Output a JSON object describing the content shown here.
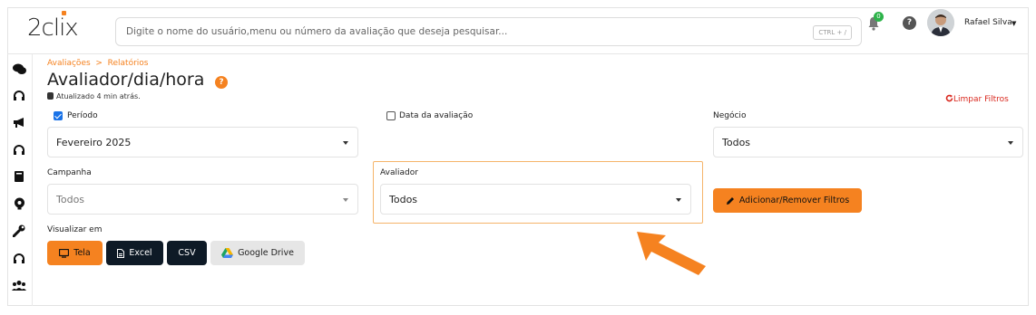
{
  "header": {
    "logo_text_a": "2cl",
    "logo_text_b": "i",
    "logo_text_c": "x",
    "search_placeholder": "Digite o nome do usuário,menu ou número da avaliação que deseja pesquisar...",
    "search_shortcut": "CTRL + /",
    "notification_count": "0",
    "help_glyph": "?",
    "user_name": "Rafael Silva",
    "user_caret": "▼"
  },
  "breadcrumb": {
    "text": "Avaliações  >  Relatórios"
  },
  "page": {
    "title": "Avaliador/dia/hora",
    "title_help_glyph": "?",
    "updated": "Atualizado 4 min atrás.",
    "clear_filters": "Limpar Filtros"
  },
  "filters": {
    "periodo_label": "Período",
    "periodo_checked": true,
    "periodo_value": "Fevereiro 2025",
    "data_avaliacao_label": "Data da avaliação",
    "data_avaliacao_checked": false,
    "negocio_label": "Negócio",
    "negocio_value": "Todos",
    "campanha_label": "Campanha",
    "campanha_value": "Todos",
    "avaliador_label": "Avaliador",
    "avaliador_value": "Todos",
    "add_remove_label": "Adicionar/Remover Filtros"
  },
  "view_in": {
    "label": "Visualizar em",
    "buttons": [
      {
        "label": "Tela",
        "icon": "monitor-icon"
      },
      {
        "label": "Excel",
        "icon": "document-icon"
      },
      {
        "label": "CSV",
        "icon": ""
      },
      {
        "label": "Google Drive",
        "icon": "google-drive-icon"
      }
    ]
  },
  "sidebar": {
    "icons": [
      "chat-icon",
      "headset-icon",
      "megaphone-icon",
      "headset-icon",
      "book-icon",
      "lightbulb-icon",
      "wrench-icon",
      "headset-icon",
      "users-icon"
    ]
  },
  "colors": {
    "accent": "#f58220",
    "dark_button": "#0e1a26",
    "danger": "#d9281e",
    "checkbox": "#1a73e8",
    "badge": "#2db34a"
  }
}
